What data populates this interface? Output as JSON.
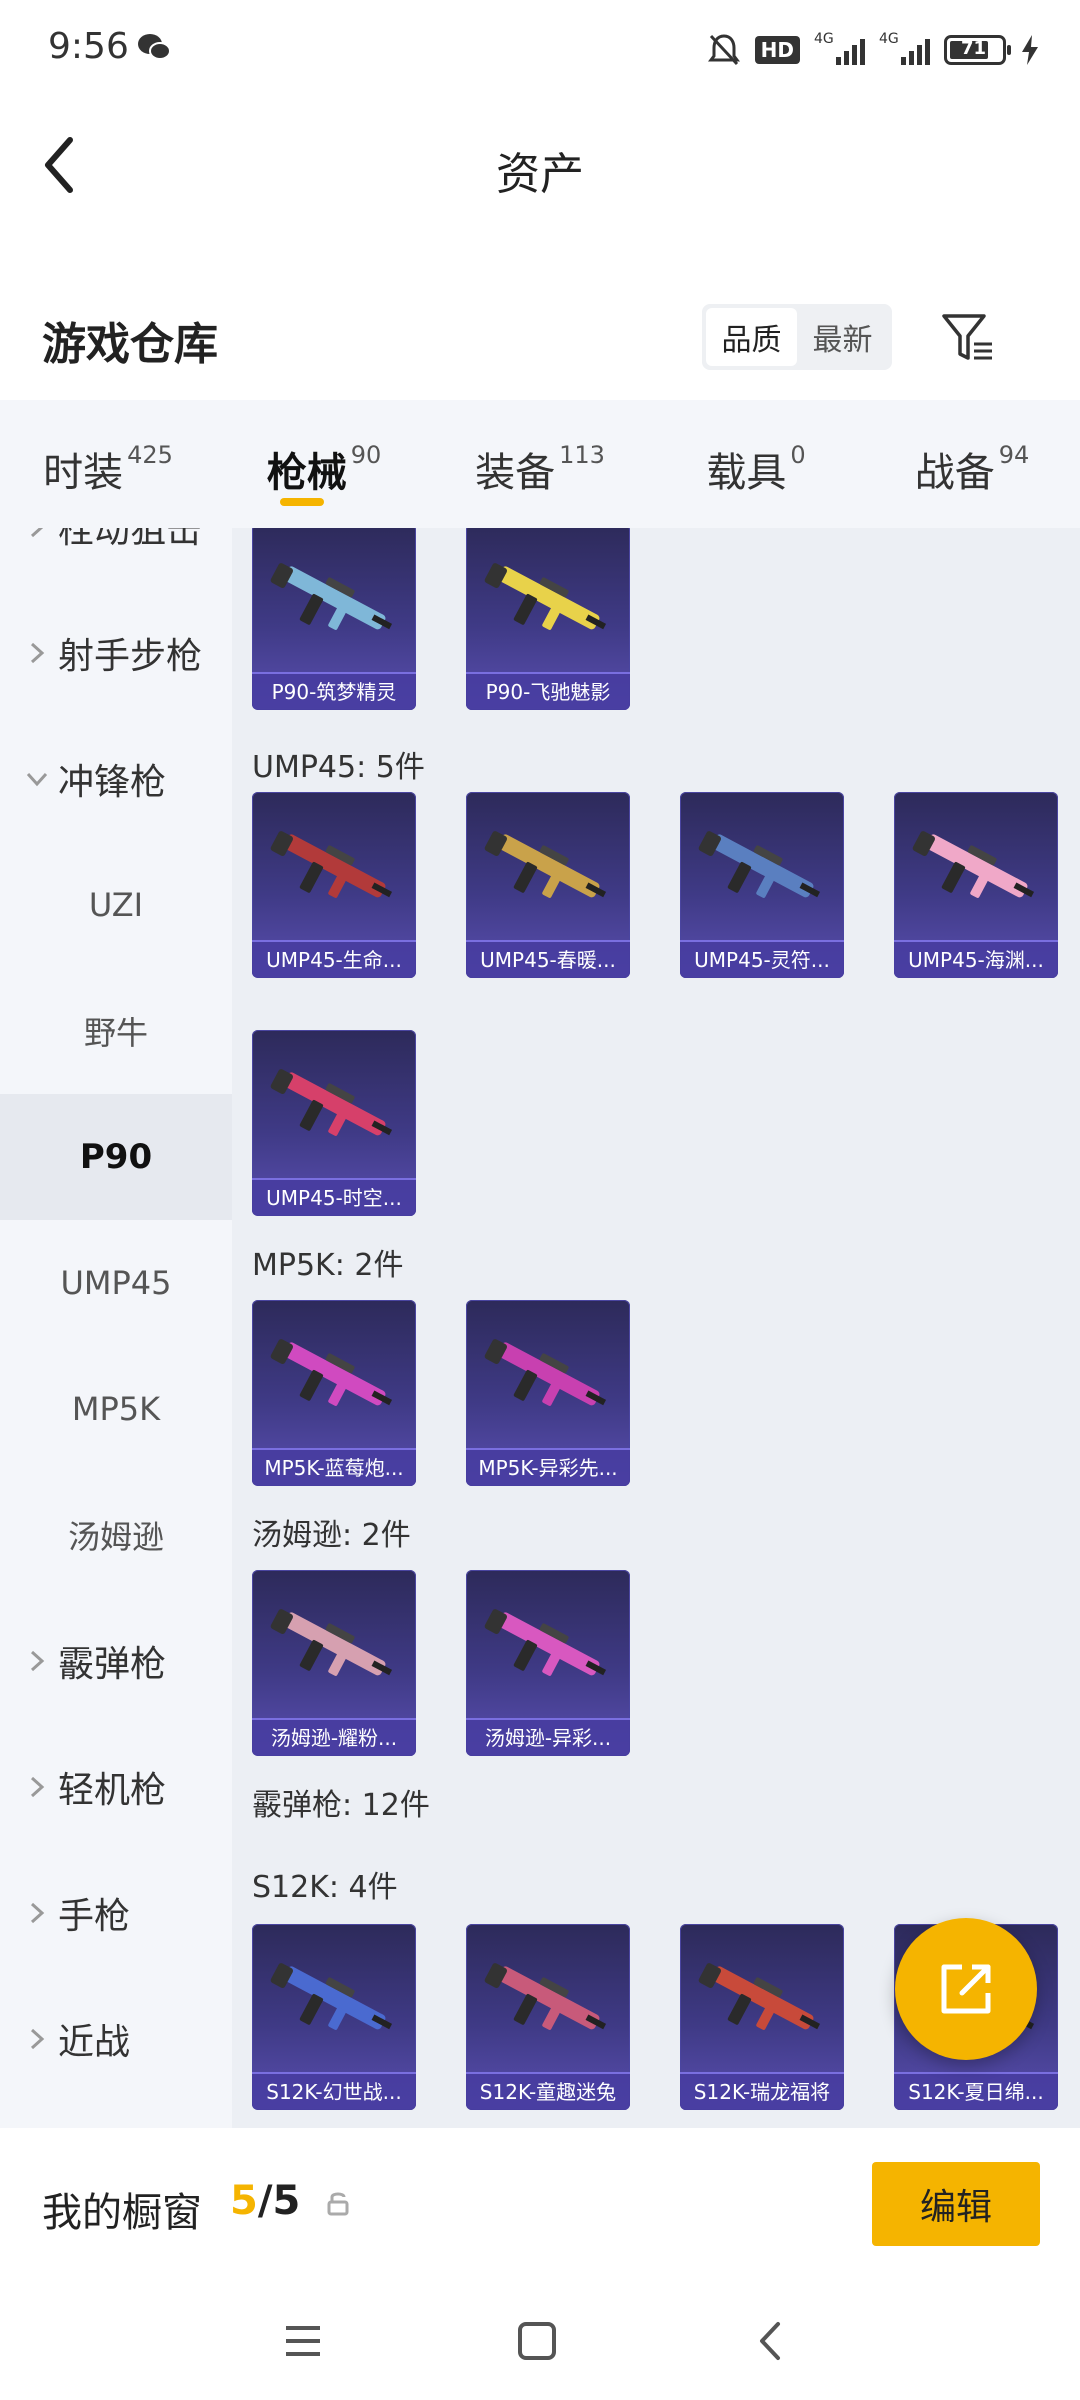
{
  "status_bar": {
    "time": "9:56",
    "network_hd": "HD",
    "signal_1": "4G",
    "signal_2": "4G",
    "battery": "71"
  },
  "header": {
    "title": "资产"
  },
  "warehouse": {
    "title": "游戏仓库",
    "sort_options": [
      "品质",
      "最新"
    ],
    "active_sort": "品质"
  },
  "tabs": [
    {
      "label": "时装",
      "count": "425"
    },
    {
      "label": "枪械",
      "count": "90",
      "active": true
    },
    {
      "label": "装备",
      "count": "113"
    },
    {
      "label": "载具",
      "count": "0"
    },
    {
      "label": "战备",
      "count": "94"
    }
  ],
  "sidebar": {
    "items": [
      {
        "label": "栓动狙击",
        "type": "category",
        "expanded": false
      },
      {
        "label": "射手步枪",
        "type": "category",
        "expanded": false
      },
      {
        "label": "冲锋枪",
        "type": "category",
        "expanded": true
      },
      {
        "label": "UZI",
        "type": "sub"
      },
      {
        "label": "野牛",
        "type": "sub"
      },
      {
        "label": "P90",
        "type": "sub",
        "selected": true
      },
      {
        "label": "UMP45",
        "type": "sub"
      },
      {
        "label": "MP5K",
        "type": "sub"
      },
      {
        "label": "汤姆逊",
        "type": "sub"
      },
      {
        "label": "霰弹枪",
        "type": "category",
        "expanded": false
      },
      {
        "label": "轻机枪",
        "type": "category",
        "expanded": false
      },
      {
        "label": "手枪",
        "type": "category",
        "expanded": false
      },
      {
        "label": "近战",
        "type": "category",
        "expanded": false
      }
    ]
  },
  "groups": [
    {
      "label": "",
      "items": [
        {
          "name": "P90-筑梦精灵",
          "color": "#7fb7d8"
        },
        {
          "name": "P90-飞驰魅影",
          "color": "#e8d24a"
        }
      ]
    },
    {
      "label": "UMP45: 5件",
      "items": [
        {
          "name": "UMP45-生命...",
          "color": "#b23a3a"
        },
        {
          "name": "UMP45-春暖...",
          "color": "#c9a24a"
        },
        {
          "name": "UMP45-灵符...",
          "color": "#5a7fc0"
        },
        {
          "name": "UMP45-海渊...",
          "color": "#f0a8c8"
        },
        {
          "name": "UMP45-时空...",
          "color": "#d6406a"
        }
      ]
    },
    {
      "label": "MP5K: 2件",
      "items": [
        {
          "name": "MP5K-蓝莓炮...",
          "color": "#d04ac0"
        },
        {
          "name": "MP5K-异彩先...",
          "color": "#c840b0"
        }
      ]
    },
    {
      "label": "汤姆逊: 2件",
      "items": [
        {
          "name": "汤姆逊-耀粉...",
          "color": "#d6a0b0"
        },
        {
          "name": "汤姆逊-异彩...",
          "color": "#d858c0"
        }
      ]
    },
    {
      "label": "霰弹枪: 12件",
      "items": []
    },
    {
      "label": "S12K: 4件",
      "items": [
        {
          "name": "S12K-幻世战...",
          "color": "#4a6ad0"
        },
        {
          "name": "S12K-童趣迷兔",
          "color": "#c85a7a"
        },
        {
          "name": "S12K-瑞龙福将",
          "color": "#c84a3a"
        },
        {
          "name": "S12K-夏日绵...",
          "color": "#e0a060"
        }
      ]
    }
  ],
  "showcase": {
    "label": "我的橱窗",
    "current": "5",
    "separator": "/",
    "total": "5",
    "edit_label": "编辑"
  },
  "colors": {
    "accent": "#f5b400",
    "card_bg": "#3f3a86"
  }
}
